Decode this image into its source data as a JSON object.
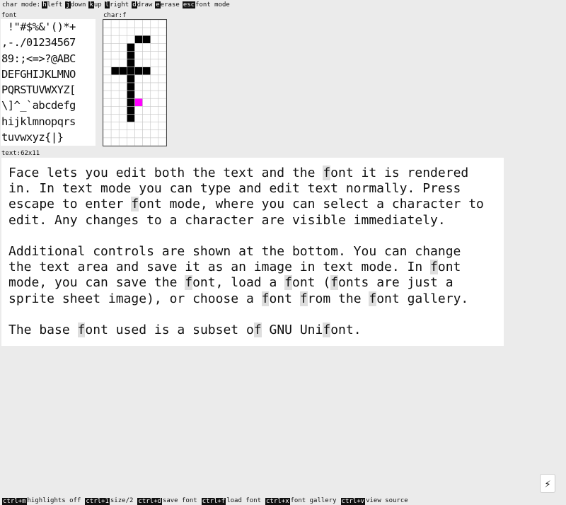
{
  "char_mode_bar": {
    "label": "char mode:",
    "hints": [
      {
        "key": "h",
        "action": "left"
      },
      {
        "key": "j",
        "action": "down"
      },
      {
        "key": "k",
        "action": "up"
      },
      {
        "key": "l",
        "action": "right"
      },
      {
        "key": "d",
        "action": "draw"
      },
      {
        "key": "e",
        "action": "erase"
      },
      {
        "key": "esc",
        "action": "font mode"
      }
    ]
  },
  "font_panel": {
    "label": "font",
    "rows": [
      " !\"#$%&'()*+",
      ",-./01234567",
      "89:;<=>?@ABC",
      "DEFGHIJKLMNO",
      "PQRSTUVWXYZ[",
      "\\]^_`abcdefg",
      "hijklmnopqrs",
      "tuvwxyz{|}"
    ]
  },
  "char_editor": {
    "label": "char:f",
    "cols": 8,
    "rows": 16,
    "filled": [
      [
        2,
        4
      ],
      [
        2,
        5
      ],
      [
        3,
        3
      ],
      [
        4,
        3
      ],
      [
        5,
        3
      ],
      [
        6,
        1
      ],
      [
        6,
        2
      ],
      [
        6,
        3
      ],
      [
        6,
        4
      ],
      [
        6,
        5
      ],
      [
        7,
        3
      ],
      [
        8,
        3
      ],
      [
        9,
        3
      ],
      [
        10,
        3
      ],
      [
        11,
        3
      ],
      [
        12,
        3
      ]
    ],
    "cursor": [
      10,
      4
    ],
    "cursor_color": "#ff00ff"
  },
  "text_panel": {
    "label": "text:62x11",
    "paragraphs": [
      [
        {
          "t": "Face lets you edit both the text and the "
        },
        {
          "t": "f",
          "hl": true
        },
        {
          "t": "ont it is rendered\nin. In text mode you can type and edit text normally. Press\nescape to enter "
        },
        {
          "t": "f",
          "hl": true
        },
        {
          "t": "ont mode, where you can select a character to\nedit. Any changes to a character are visible immediately."
        }
      ],
      [
        {
          "t": "Additional controls are shown at the bottom. You can change\nthe text area and save it as an image in text mode. In "
        },
        {
          "t": "f",
          "hl": true
        },
        {
          "t": "ont\nmode, you can save the "
        },
        {
          "t": "f",
          "hl": true
        },
        {
          "t": "ont, load a "
        },
        {
          "t": "f",
          "hl": true
        },
        {
          "t": "ont ("
        },
        {
          "t": "f",
          "hl": true
        },
        {
          "t": "onts are just a\nsprite sheet image), or choose a "
        },
        {
          "t": "f",
          "hl": true
        },
        {
          "t": "ont "
        },
        {
          "t": "f",
          "hl": true
        },
        {
          "t": "rom the "
        },
        {
          "t": "f",
          "hl": true
        },
        {
          "t": "ont gallery."
        }
      ],
      [
        {
          "t": "The base "
        },
        {
          "t": "f",
          "hl": true
        },
        {
          "t": "ont used is a subset o"
        },
        {
          "t": "f",
          "hl": true
        },
        {
          "t": " GNU Uni"
        },
        {
          "t": "f",
          "hl": true
        },
        {
          "t": "ont."
        }
      ]
    ]
  },
  "bottom_bar": {
    "hints": [
      {
        "key": "ctrl+m",
        "action": "highlights off"
      },
      {
        "key": "ctrl+1",
        "action": "size/2"
      },
      {
        "key": "ctrl+d",
        "action": "save font"
      },
      {
        "key": "ctrl+f",
        "action": "load font"
      },
      {
        "key": "ctrl+x",
        "action": "font gallery"
      },
      {
        "key": "ctrl+v",
        "action": "view source"
      }
    ]
  },
  "flash_button": {
    "icon": "lightning-icon",
    "glyph": "⚡"
  }
}
